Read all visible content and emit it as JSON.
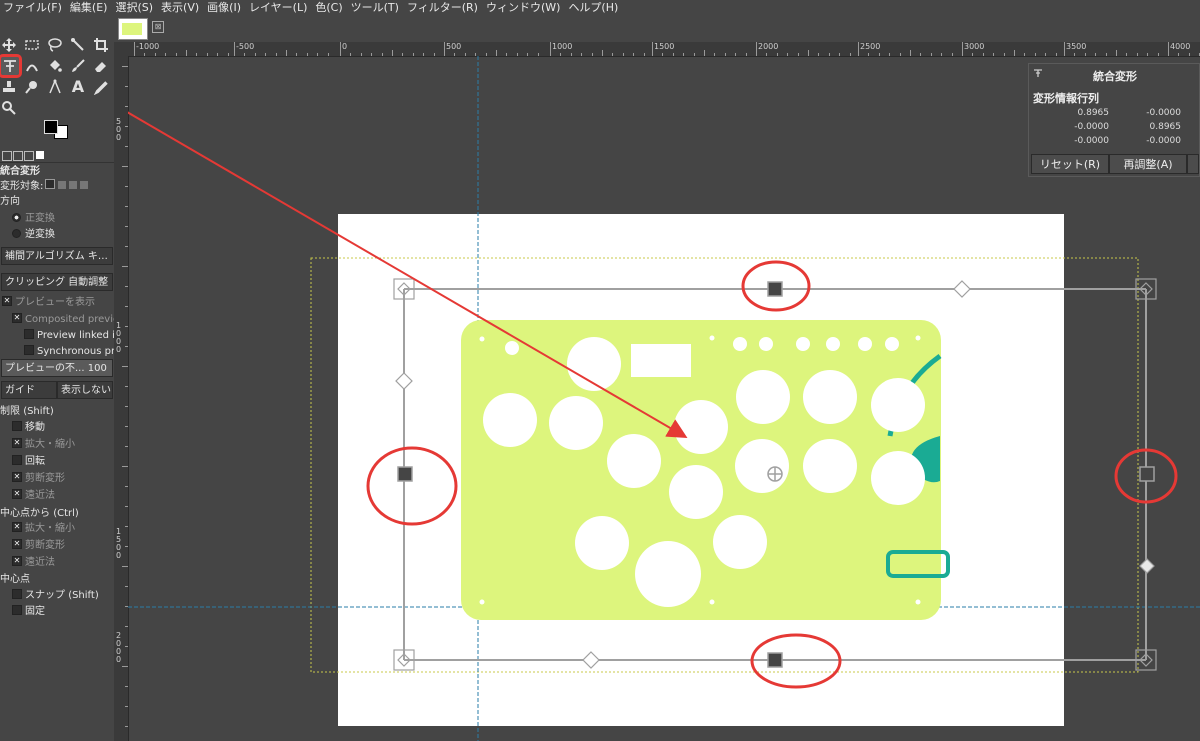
{
  "menu": [
    "ファイル(F)",
    "編集(E)",
    "選択(S)",
    "表示(V)",
    "画像(I)",
    "レイヤー(L)",
    "色(C)",
    "ツール(T)",
    "フィルター(R)",
    "ウィンドウ(W)",
    "ヘルプ(H)"
  ],
  "tools": {
    "row1": [
      "move-tool-icon",
      "rect-select-icon",
      "lasso-icon",
      "fuzzy-select-icon",
      "crop-icon"
    ],
    "row2": [
      "unified-transform-icon",
      "warp-icon",
      "bucket-fill-icon",
      "paintbrush-icon",
      "eraser-icon"
    ],
    "row3": [
      "clone-icon",
      "smudge-icon",
      "path-icon",
      "text-icon",
      "color-picker-icon"
    ],
    "row4": [
      "zoom-icon"
    ]
  },
  "tool_options": {
    "title": "統合変形",
    "transform_label": "変形対象:",
    "direction_label": "方向",
    "direction_options": [
      "正変換",
      "逆変換"
    ],
    "interpolation": "補間アルゴリズム キ…",
    "clipping": "クリッピング 自動調整",
    "show_preview": "プレビューを表示",
    "composited_preview": "Composited preview",
    "preview_linked": "Preview linked ite",
    "synchronous_preview": "Synchronous pre",
    "preview_opacity": "プレビューの不... 100",
    "guide_label": "ガイド",
    "guide_value": "表示しない",
    "constrain_label": "制限",
    "constrain_key": "(Shift)",
    "constrain_items": [
      {
        "label": "移動",
        "checked": false
      },
      {
        "label": "拡大・縮小",
        "checked": true
      },
      {
        "label": "回転",
        "checked": false
      },
      {
        "label": "剪断変形",
        "checked": true
      },
      {
        "label": "遠近法",
        "checked": true
      }
    ],
    "from_pivot_label": "中心点から",
    "from_pivot_key": "(Ctrl)",
    "from_pivot_items": [
      {
        "label": "拡大・縮小",
        "checked": true
      },
      {
        "label": "剪断変形",
        "checked": true
      },
      {
        "label": "遠近法",
        "checked": true
      }
    ],
    "pivot_label": "中心点",
    "pivot_items": [
      {
        "label": "スナップ",
        "key": "(Shift)",
        "checked": false
      },
      {
        "label": "固定",
        "checked": false
      }
    ]
  },
  "image_tab": {
    "close_symbol": "⊠"
  },
  "ruler": {
    "h_labels": [
      "-1000",
      "-500",
      "0",
      "500",
      "1000",
      "1500",
      "2000",
      "2500",
      "3000",
      "3500",
      "4000"
    ],
    "v_labels": [
      "500",
      "1000",
      "1500",
      "2000"
    ]
  },
  "dialog": {
    "title": "統合変形",
    "matrix_label": "変形情報行列",
    "matrix": [
      [
        "0.8965",
        "-0.0000"
      ],
      [
        "-0.0000",
        "0.8965"
      ],
      [
        "-0.0000",
        "-0.0000"
      ]
    ],
    "reset_button": "リセット(R)",
    "readjust_button": "再調整(A)"
  },
  "colors": {
    "plate": "#ddf57d",
    "teal": "#1aab94",
    "annotation": "#e53935",
    "handle": "#a0a0a0",
    "guide": "#2a7da8",
    "layer_boundary": "#c8c84a"
  }
}
